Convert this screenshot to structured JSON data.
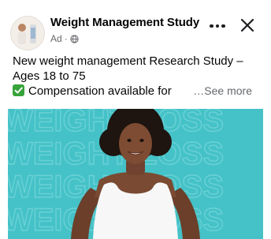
{
  "ad": {
    "page_name": "Weight Management Study",
    "sponsored_label": "Ad",
    "privacy_icon": "globe-icon",
    "more_icon": "more-horizontal-icon",
    "close_icon": "close-icon",
    "text_line1": "New weight management Research Study –",
    "text_line2": "Ages 18 to 75",
    "text_line3": "Compensation available for",
    "check_icon": "check-mark-button-icon",
    "see_more": "…See more",
    "image": {
      "background_color": "#45c2c7",
      "watermark_text": "WEIGHT LOSS",
      "description": "woman in white tank top with hands on hips"
    }
  }
}
